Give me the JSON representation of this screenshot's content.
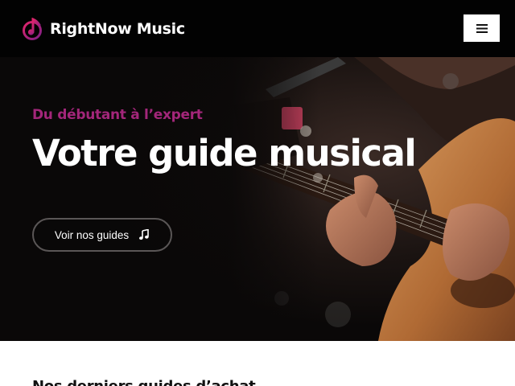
{
  "header": {
    "logo_text": "RightNow Music",
    "logo_icon": "music-note-circle-icon",
    "menu_icon": "hamburger-menu-icon",
    "brand_gradient": [
      "#e3256b",
      "#7b1f86"
    ]
  },
  "hero": {
    "eyebrow": "Du débutant à l’expert",
    "title": "Votre guide musical",
    "cta_label": "Voir nos guides",
    "cta_icon": "music-note-icon",
    "eyebrow_color": "#a3267a",
    "image_subject": "guitarist-playing-acoustic-guitar"
  },
  "section": {
    "title_partial": "Nos derniers guides d’achat"
  }
}
